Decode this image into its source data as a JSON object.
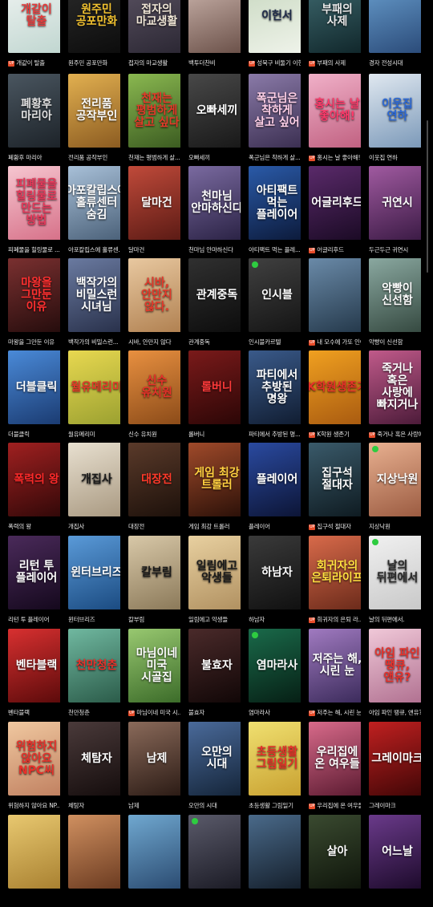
{
  "badge_label": "UP",
  "rows": [
    {
      "items": [
        {
          "caption": "개같이 탈출",
          "cover_text": "개같이 탈출",
          "badge": true,
          "new": false,
          "colors": [
            "#f0f4f2",
            "#c0d6d0"
          ],
          "text_color": "#e73b3b"
        },
        {
          "caption": "원주민 공포만화",
          "cover_text": "원주민 공포만화",
          "badge": false,
          "new": false,
          "colors": [
            "#2a2a2a",
            "#0c0c0c"
          ],
          "text_color": "#f2c230"
        },
        {
          "caption": "접자의 마교생활",
          "cover_text": "접자의 마교생활",
          "badge": false,
          "new": false,
          "colors": [
            "#5b5363",
            "#2b2733"
          ],
          "text_color": "#f0e6d6"
        },
        {
          "caption": "백투더찬비",
          "cover_text": "",
          "badge": false,
          "new": false,
          "colors": [
            "#cfb8b0",
            "#6a5048"
          ],
          "text_color": "#ffffff"
        },
        {
          "caption": "성북구 비둘기 이헌서",
          "cover_text": "이헌서",
          "badge": true,
          "new": false,
          "colors": [
            "#c8d8c0",
            "#eff3ea"
          ],
          "text_color": "#1f2a4a"
        },
        {
          "caption": "부패의 사제",
          "cover_text": "부패의 사제",
          "badge": true,
          "new": false,
          "colors": [
            "#3f6a70",
            "#10262a"
          ],
          "text_color": "#e8e8e8"
        },
        {
          "caption": "경자 전성시대",
          "cover_text": "",
          "badge": false,
          "new": false,
          "colors": [
            "#6aa0d0",
            "#2a4a78"
          ],
          "text_color": "#ffffff"
        }
      ]
    },
    {
      "items": [
        {
          "caption": "폐황후 마리아",
          "cover_text": "폐황후 마리아",
          "badge": false,
          "new": false,
          "colors": [
            "#4a5660",
            "#1c2228"
          ],
          "text_color": "#e0e0e0"
        },
        {
          "caption": "전리품 공작부인",
          "cover_text": "전리품 공작부인",
          "badge": false,
          "new": false,
          "colors": [
            "#e2b050",
            "#8a5a20"
          ],
          "text_color": "#ffffff"
        },
        {
          "caption": "천재는 평범하게 살...",
          "cover_text": "천재는 평범하게 살고 싶다",
          "badge": false,
          "new": false,
          "colors": [
            "#8ab850",
            "#3a5a20"
          ],
          "text_color": "#e53a2a"
        },
        {
          "caption": "오빠세끼",
          "cover_text": "오빠세끼",
          "badge": false,
          "new": false,
          "colors": [
            "#484848",
            "#181818"
          ],
          "text_color": "#ffffff"
        },
        {
          "caption": "폭군님은 착하게 살...",
          "cover_text": "폭군님은 착하게 살고 싶어",
          "badge": false,
          "new": false,
          "colors": [
            "#8a7aa8",
            "#3a2e50"
          ],
          "text_color": "#ffd0e8"
        },
        {
          "caption": "홍시는 날 좋아해!",
          "cover_text": "홍시는 날 좋아해!",
          "badge": true,
          "new": false,
          "colors": [
            "#f0b0c8",
            "#c06080"
          ],
          "text_color": "#ff3a6a"
        },
        {
          "caption": "이웃집 연하",
          "cover_text": "이웃집 연하",
          "badge": false,
          "new": false,
          "colors": [
            "#e0e8f0",
            "#7a98b8"
          ],
          "text_color": "#2a68d8"
        }
      ]
    },
    {
      "items": [
        {
          "caption": "피폐물을 힐링물로 ...",
          "cover_text": "피폐물을 힐링물로 만드는 방법",
          "badge": false,
          "new": false,
          "colors": [
            "#f6c6d0",
            "#d67088"
          ],
          "text_color": "#e8385a"
        },
        {
          "caption": "아포칼립스에 홀류센...",
          "cover_text": "아포칼립스에 홀류센터 숨김",
          "badge": false,
          "new": false,
          "colors": [
            "#a8c0d8",
            "#4a6078"
          ],
          "text_color": "#ffffff"
        },
        {
          "caption": "달마건",
          "cover_text": "달마건",
          "badge": false,
          "new": false,
          "colors": [
            "#c04a3a",
            "#5a1a14"
          ],
          "text_color": "#ffffff"
        },
        {
          "caption": "천마님 안마하신다",
          "cover_text": "천마님 안마하신다",
          "badge": false,
          "new": false,
          "colors": [
            "#7a6aa0",
            "#2a2244"
          ],
          "text_color": "#ffffff"
        },
        {
          "caption": "아티팩트 먹는 플레...",
          "cover_text": "아티팩트 먹는 플레이어",
          "badge": false,
          "new": false,
          "colors": [
            "#2a5aa8",
            "#0c1a3a"
          ],
          "text_color": "#ffffff"
        },
        {
          "caption": "어글리후드",
          "cover_text": "어글리후드",
          "badge": true,
          "new": false,
          "colors": [
            "#5a2a6a",
            "#1a0a24"
          ],
          "text_color": "#ffffff"
        },
        {
          "caption": "두근두근 귀연시",
          "cover_text": "귀연시",
          "badge": false,
          "new": false,
          "colors": [
            "#a05aa0",
            "#3a1a44"
          ],
          "text_color": "#ffffff"
        }
      ]
    },
    {
      "items": [
        {
          "caption": "마왕을 그만둔 이유",
          "cover_text": "마왕을 그만둔 이유",
          "badge": false,
          "new": false,
          "colors": [
            "#7a3030",
            "#240c0c"
          ],
          "text_color": "#ff3030"
        },
        {
          "caption": "백작가의 비밀스런...",
          "cover_text": "백작가의 비밀스런 시녀님",
          "badge": false,
          "new": false,
          "colors": [
            "#6a7aa0",
            "#28304a"
          ],
          "text_color": "#ffffff"
        },
        {
          "caption": "시바, 안만지 않다",
          "cover_text": "시바, 안만지 않다.",
          "badge": false,
          "new": false,
          "colors": [
            "#e8c8a0",
            "#b08050"
          ],
          "text_color": "#e5392a"
        },
        {
          "caption": "관계중독",
          "cover_text": "관계중독",
          "badge": false,
          "new": false,
          "colors": [
            "#303030",
            "#0c0c0c"
          ],
          "text_color": "#ffffff"
        },
        {
          "caption": "인시블카르텔",
          "cover_text": "인시블",
          "badge": false,
          "new": true,
          "colors": [
            "#404040",
            "#141414"
          ],
          "text_color": "#ffffff"
        },
        {
          "caption": "내 모수에 가또 인어",
          "cover_text": "",
          "badge": true,
          "new": false,
          "colors": [
            "#6a8aa8",
            "#24384a"
          ],
          "text_color": "#ffffff"
        },
        {
          "caption": "악빵이 신선함",
          "cover_text": "악빵이 신선함",
          "badge": false,
          "new": false,
          "colors": [
            "#8aa8a0",
            "#34483f"
          ],
          "text_color": "#ffffff"
        }
      ]
    },
    {
      "items": [
        {
          "caption": "더블클릭",
          "cover_text": "더블클릭",
          "badge": false,
          "new": false,
          "colors": [
            "#4a8ad8",
            "#1a3a70"
          ],
          "text_color": "#ffffff"
        },
        {
          "caption": "월유메리미",
          "cover_text": "월유메리미",
          "badge": false,
          "new": false,
          "colors": [
            "#e8d850",
            "#9aa030"
          ],
          "text_color": "#e53a2a"
        },
        {
          "caption": "신수 유치원",
          "cover_text": "신수 유치원",
          "badge": false,
          "new": false,
          "colors": [
            "#e89040",
            "#8a4a18"
          ],
          "text_color": "#e8302a"
        },
        {
          "caption": "롤버니",
          "cover_text": "롤버니",
          "badge": false,
          "new": false,
          "colors": [
            "#7a1a1a",
            "#2a0606"
          ],
          "text_color": "#ff3a3a"
        },
        {
          "caption": "파티에서 추방된 명...",
          "cover_text": "파티에서 추방된 명왕",
          "badge": false,
          "new": false,
          "colors": [
            "#3a5a8a",
            "#101c30"
          ],
          "text_color": "#ffffff"
        },
        {
          "caption": "K학원 생존기",
          "cover_text": "K학원생존기",
          "badge": true,
          "new": false,
          "colors": [
            "#f0a020",
            "#a85a10"
          ],
          "text_color": "#e8302a"
        },
        {
          "caption": "죽거나 혹은 사랑에 ...",
          "cover_text": "죽거나 혹은 사랑에 빠지거나",
          "badge": true,
          "new": false,
          "colors": [
            "#c05a8a",
            "#4a1a38"
          ],
          "text_color": "#ffffff"
        }
      ]
    },
    {
      "items": [
        {
          "caption": "폭력의 왕",
          "cover_text": "폭력의 왕",
          "badge": false,
          "new": false,
          "colors": [
            "#a02020",
            "#300808"
          ],
          "text_color": "#ff2a2a"
        },
        {
          "caption": "개집사",
          "cover_text": "개집사",
          "badge": false,
          "new": false,
          "colors": [
            "#e8e0d0",
            "#a89880"
          ],
          "text_color": "#1a1a1a"
        },
        {
          "caption": "대장전",
          "cover_text": "대장전",
          "badge": false,
          "new": false,
          "colors": [
            "#5a3a2a",
            "#1c100a"
          ],
          "text_color": "#ff3a2a"
        },
        {
          "caption": "게임 최강 트롤러",
          "cover_text": "게임 최강 트롤러",
          "badge": false,
          "new": false,
          "colors": [
            "#a04a2a",
            "#2a1008"
          ],
          "text_color": "#ffd040"
        },
        {
          "caption": "플레이어",
          "cover_text": "플레이어",
          "badge": false,
          "new": false,
          "colors": [
            "#2a4aa0",
            "#0c1434"
          ],
          "text_color": "#ffffff"
        },
        {
          "caption": "집구석 절대자",
          "cover_text": "집구석 절대자",
          "badge": true,
          "new": false,
          "colors": [
            "#3a5a6a",
            "#0e1a20"
          ],
          "text_color": "#ffffff"
        },
        {
          "caption": "지상낙원",
          "cover_text": "지상낙원",
          "badge": false,
          "new": true,
          "colors": [
            "#e8b090",
            "#9a5a40"
          ],
          "text_color": "#ffffff"
        }
      ]
    },
    {
      "items": [
        {
          "caption": "리턴 투 플레이어",
          "cover_text": "리턴 투 플레이어",
          "badge": false,
          "new": false,
          "colors": [
            "#4a2a5a",
            "#14081c"
          ],
          "text_color": "#ffffff"
        },
        {
          "caption": "윈터브리즈",
          "cover_text": "윈터브리즈",
          "badge": false,
          "new": false,
          "colors": [
            "#5a9ad8",
            "#1a4a80"
          ],
          "text_color": "#ffffff"
        },
        {
          "caption": "칼부림",
          "cover_text": "칼부림",
          "badge": false,
          "new": false,
          "colors": [
            "#d8c8a8",
            "#8a7858"
          ],
          "text_color": "#1a1a1a"
        },
        {
          "caption": "일림에고 악생들",
          "cover_text": "일림에고 악생들",
          "badge": false,
          "new": false,
          "colors": [
            "#e8d0a0",
            "#b09060"
          ],
          "text_color": "#1a1a1a"
        },
        {
          "caption": "하남자",
          "cover_text": "하남자",
          "badge": false,
          "new": false,
          "colors": [
            "#3a3a3a",
            "#101010"
          ],
          "text_color": "#ffffff"
        },
        {
          "caption": "회귀자의 은퇴 라...",
          "cover_text": "회귀자의 은퇴라이프",
          "badge": true,
          "new": false,
          "colors": [
            "#d86a4a",
            "#6a2a1a"
          ],
          "text_color": "#ffe040"
        },
        {
          "caption": "날의 뒤편에서.",
          "cover_text": "날의 뒤편에서",
          "badge": false,
          "new": true,
          "colors": [
            "#f0f0f0",
            "#c8c8c8"
          ],
          "text_color": "#2a2a2a"
        }
      ]
    },
    {
      "items": [
        {
          "caption": "벤타블랙",
          "cover_text": "벤타블랙",
          "badge": false,
          "new": false,
          "colors": [
            "#d83030",
            "#5a0a0a"
          ],
          "text_color": "#ffffff"
        },
        {
          "caption": "천만청춘",
          "cover_text": "천만청춘",
          "badge": false,
          "new": false,
          "colors": [
            "#70b8a0",
            "#2a5a48"
          ],
          "text_color": "#e8302a"
        },
        {
          "caption": "마님이네 미국 시...",
          "cover_text": "마님이네 미국 시골집",
          "badge": true,
          "new": false,
          "colors": [
            "#98c870",
            "#3a6a28"
          ],
          "text_color": "#ffffff"
        },
        {
          "caption": "불효자",
          "cover_text": "불효자",
          "badge": false,
          "new": false,
          "colors": [
            "#4a2a2a",
            "#100606"
          ],
          "text_color": "#ffffff"
        },
        {
          "caption": "염마라사",
          "cover_text": "염마라사",
          "badge": false,
          "new": true,
          "colors": [
            "#1a6a4a",
            "#061e14"
          ],
          "text_color": "#ffffff"
        },
        {
          "caption": "저주는 해, 시린 눈",
          "cover_text": "저주는 해, 시린 눈",
          "badge": true,
          "new": false,
          "colors": [
            "#a07ac0",
            "#3a2a5a"
          ],
          "text_color": "#ffffff"
        },
        {
          "caption": "아임 파인 땡큐, 앤유?",
          "cover_text": "아임 파인 땡큐, 앤유?",
          "badge": false,
          "new": false,
          "colors": [
            "#f0c8d8",
            "#b07090"
          ],
          "text_color": "#e8302a"
        }
      ]
    },
    {
      "items": [
        {
          "caption": "위험하지 않아요 NP...",
          "cover_text": "위험하지 않아요 NPC씨",
          "badge": false,
          "new": false,
          "colors": [
            "#f0c8a0",
            "#c08060"
          ],
          "text_color": "#e8302a"
        },
        {
          "caption": "체탐자",
          "cover_text": "체탐자",
          "badge": false,
          "new": false,
          "colors": [
            "#4a3a3a",
            "#140c0c"
          ],
          "text_color": "#ffffff"
        },
        {
          "caption": "남제",
          "cover_text": "남제",
          "badge": false,
          "new": false,
          "colors": [
            "#8a6a5a",
            "#2a1a14"
          ],
          "text_color": "#ffffff"
        },
        {
          "caption": "오만의 시대",
          "cover_text": "오만의 시대",
          "badge": false,
          "new": false,
          "colors": [
            "#4a6a9a",
            "#142438"
          ],
          "text_color": "#ffffff"
        },
        {
          "caption": "초등생활 그림일기",
          "cover_text": "초등생활 그림일기",
          "badge": false,
          "new": false,
          "colors": [
            "#f0e070",
            "#c8a030"
          ],
          "text_color": "#e8302a"
        },
        {
          "caption": "우리집에 온 여우들",
          "cover_text": "우리집에 온 여우들",
          "badge": true,
          "new": false,
          "colors": [
            "#d86a8a",
            "#5a1a30"
          ],
          "text_color": "#ffffff"
        },
        {
          "caption": "그레이마크",
          "cover_text": "그레이마크",
          "badge": false,
          "new": false,
          "colors": [
            "#c02020",
            "#400606"
          ],
          "text_color": "#ffffff"
        }
      ]
    },
    {
      "items": [
        {
          "caption": "",
          "cover_text": "",
          "badge": false,
          "new": false,
          "colors": [
            "#e8c870",
            "#a88030"
          ],
          "text_color": "#e8302a"
        },
        {
          "caption": "",
          "cover_text": "",
          "badge": false,
          "new": false,
          "colors": [
            "#d09060",
            "#6a3a20"
          ],
          "text_color": "#ffffff"
        },
        {
          "caption": "",
          "cover_text": "",
          "badge": false,
          "new": false,
          "colors": [
            "#70a8d0",
            "#2a4a70"
          ],
          "text_color": "#ffffff"
        },
        {
          "caption": "",
          "cover_text": "",
          "badge": false,
          "new": true,
          "colors": [
            "#5a5a6a",
            "#1a1a24"
          ],
          "text_color": "#ffffff"
        },
        {
          "caption": "",
          "cover_text": "",
          "badge": false,
          "new": false,
          "colors": [
            "#4a6a8a",
            "#141e2a"
          ],
          "text_color": "#ffffff"
        },
        {
          "caption": "",
          "cover_text": "살아",
          "badge": false,
          "new": false,
          "colors": [
            "#3a4a30",
            "#0e140a"
          ],
          "text_color": "#ffffff"
        },
        {
          "caption": "",
          "cover_text": "어느날",
          "badge": false,
          "new": false,
          "colors": [
            "#6a3a8a",
            "#1c0a2a"
          ],
          "text_color": "#ffffff"
        }
      ]
    }
  ]
}
